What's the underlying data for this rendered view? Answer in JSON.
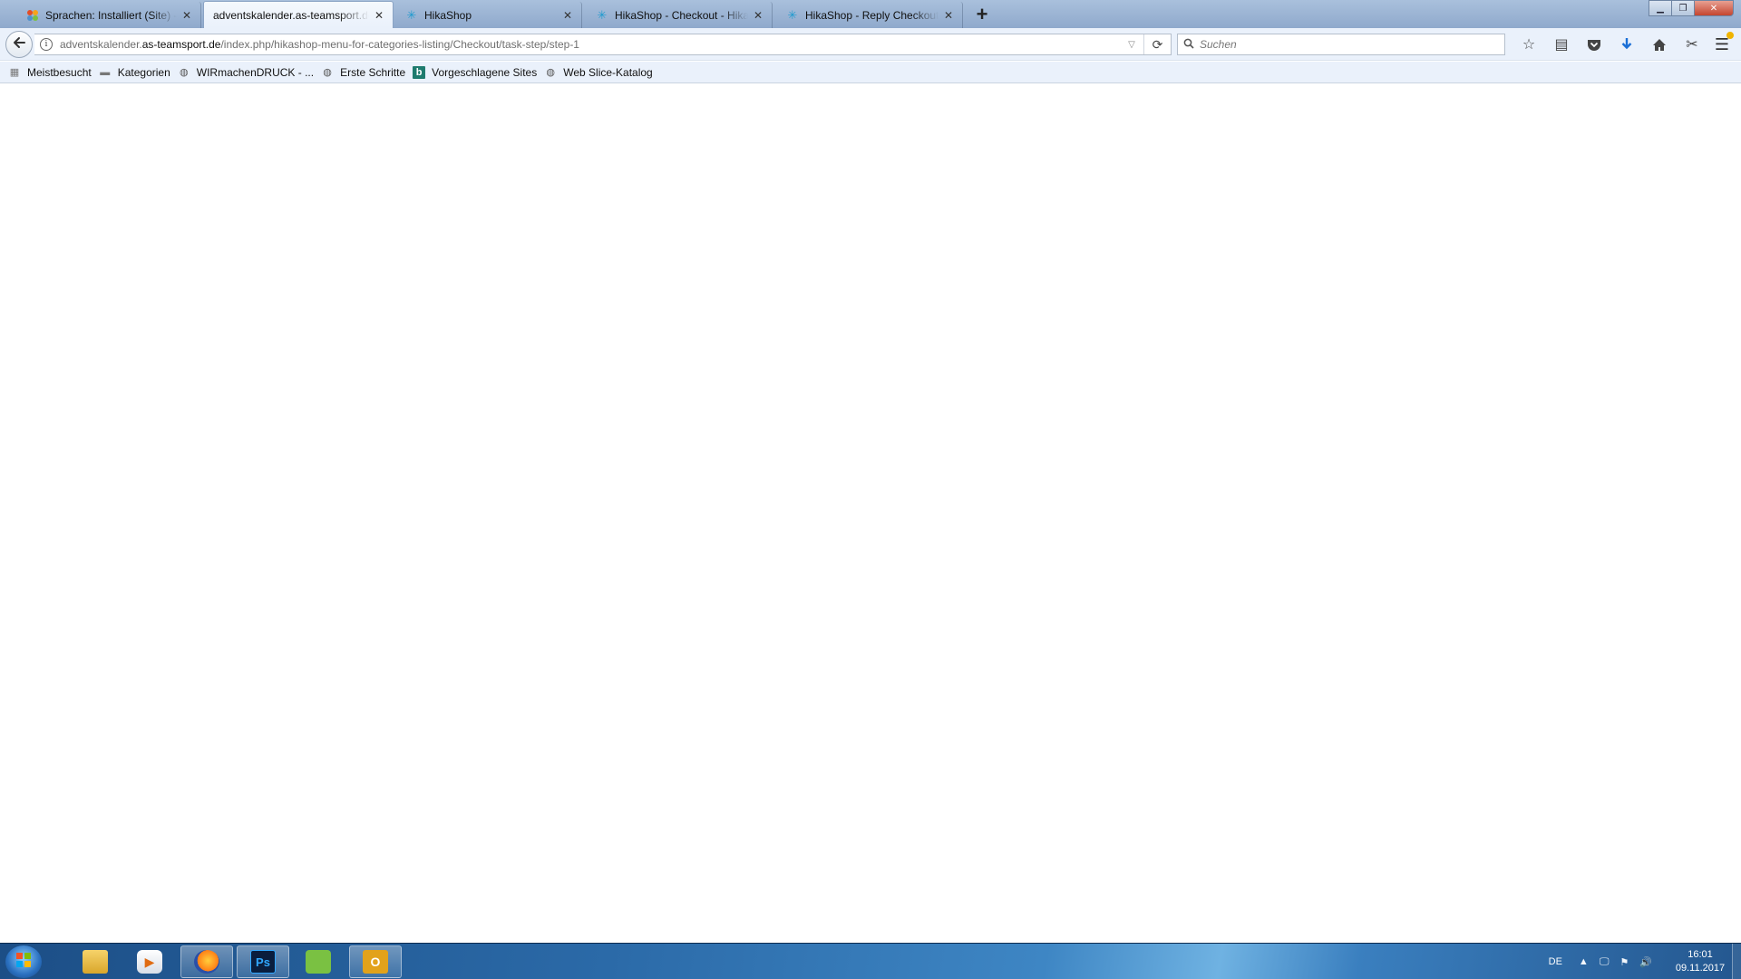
{
  "browser": {
    "tabs": [
      {
        "title": "Sprachen: Installiert (Site) - A",
        "icon": "joomla-icon",
        "active": false
      },
      {
        "title": "adventskalender.as-teamsport.de",
        "icon": "",
        "active": true
      },
      {
        "title": "HikaShop",
        "icon": "hikashop-icon",
        "active": false
      },
      {
        "title": "HikaShop - Checkout - HikaS",
        "icon": "hikashop-icon",
        "active": false
      },
      {
        "title": "HikaShop - Reply Checkout -",
        "icon": "hikashop-icon",
        "active": false
      }
    ],
    "new_tab_label": "+",
    "url": {
      "prefix": "adventskalender.",
      "host": "as-teamsport.de",
      "path": "/index.php/hikashop-menu-for-categories-listing/Checkout/task-step/step-1"
    },
    "search": {
      "placeholder": "Suchen",
      "value": ""
    },
    "toolbar_icons": [
      "star-icon",
      "reading-list-icon",
      "pocket-icon",
      "download-icon",
      "home-icon",
      "screenshot-tool-icon"
    ],
    "bookmarks": [
      {
        "label": "Meistbesucht",
        "icon": "most-visited-icon"
      },
      {
        "label": "Kategorien",
        "icon": "folder-icon"
      },
      {
        "label": "WIRmachenDRUCK - ...",
        "icon": "globe-icon"
      },
      {
        "label": "Erste Schritte",
        "icon": "globe-icon"
      },
      {
        "label": "Vorgeschlagene Sites",
        "icon": "bing-icon"
      },
      {
        "label": "Web Slice-Katalog",
        "icon": "globe-icon"
      }
    ]
  },
  "taskbar": {
    "apps": [
      {
        "name": "explorer",
        "glyph": "",
        "open": false
      },
      {
        "name": "media-player",
        "glyph": "▶",
        "open": false
      },
      {
        "name": "firefox",
        "glyph": "",
        "open": true
      },
      {
        "name": "photoshop",
        "glyph": "Ps",
        "open": true
      },
      {
        "name": "notepad-plus",
        "glyph": "",
        "open": false
      },
      {
        "name": "outlook",
        "glyph": "O",
        "open": true
      }
    ],
    "language": "DE",
    "time": "16:01",
    "date": "09.11.2017"
  },
  "colors": {
    "tabstrip": "#a9c0dc",
    "toolbar": "#eaf1fb",
    "taskbar": "#2b6aa8",
    "download_accent": "#1a6fd6"
  }
}
